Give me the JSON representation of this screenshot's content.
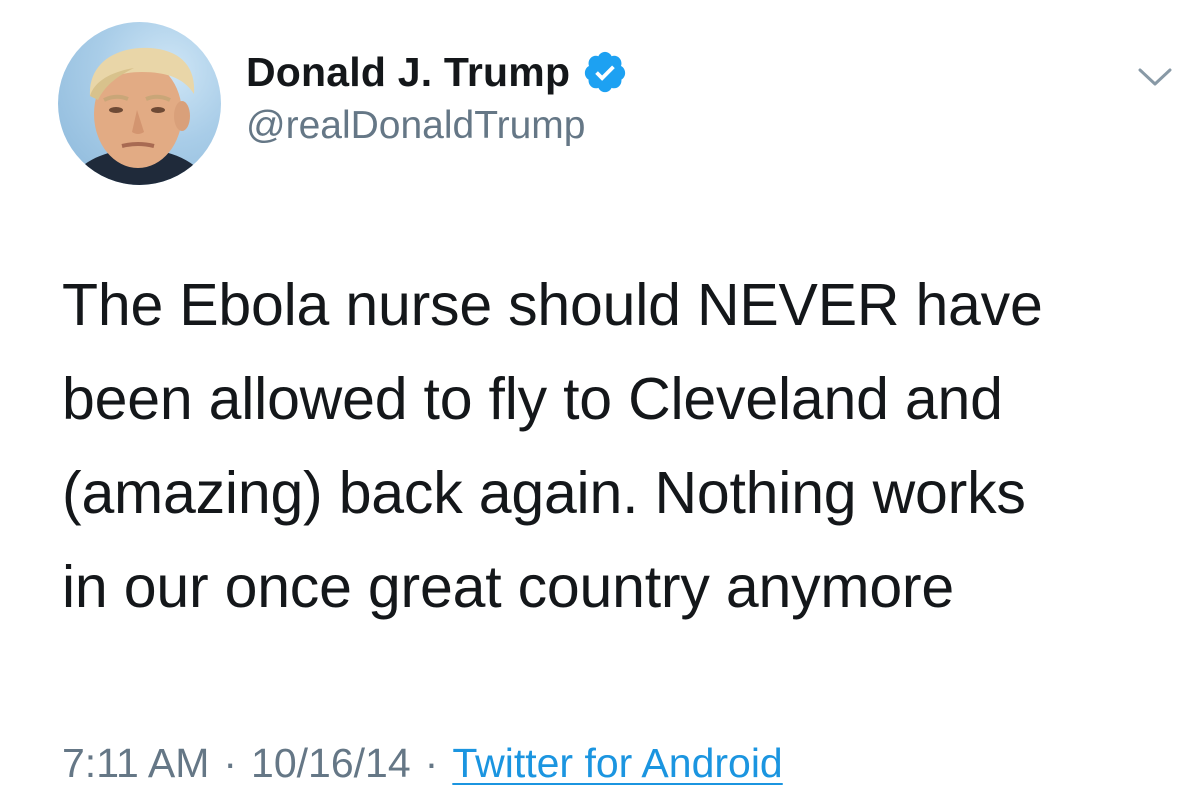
{
  "author": {
    "display_name": "Donald J. Trump",
    "handle": "@realDonaldTrump",
    "verified": true,
    "verified_badge_icon": "verified-check-icon",
    "avatar_icon": "profile-photo"
  },
  "tweet": {
    "lines": [
      "The Ebola nurse should NEVER have",
      "been allowed to fly to Cleveland and",
      "(amazing) back again. Nothing works",
      "in our once great country anymore"
    ]
  },
  "meta": {
    "time": "7:11 AM",
    "separator": "·",
    "date": "10/16/14",
    "source": "Twitter for Android"
  },
  "menu": {
    "icon": "chevron-down-icon"
  },
  "colors": {
    "text_primary": "#14171a",
    "text_secondary": "#657786",
    "link": "#1b95e0",
    "verified": "#1da1f2",
    "background": "#ffffff"
  }
}
